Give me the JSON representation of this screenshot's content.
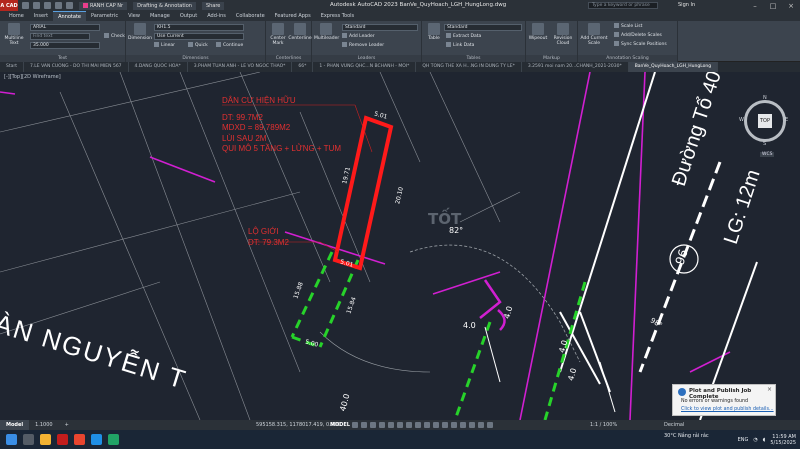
{
  "titlebar": {
    "logo": "A CAD",
    "layer_chip": "RANH CAP Nr",
    "workspace": "Drafting & Annotation",
    "share": "Share",
    "window_title": "Autodesk AutoCAD 2023    BanVe_QuyHoach_LGH_HungLong.dwg",
    "search_placeholder": "Type a keyword or phrase",
    "signin": "Sign In"
  },
  "ribbon_tabs": [
    "Home",
    "Insert",
    "Annotate",
    "Parametric",
    "View",
    "Manage",
    "Output",
    "Add-ins",
    "Collaborate",
    "Featured Apps",
    "Express Tools"
  ],
  "ribbon": {
    "text": {
      "multiline": "Multiline Text",
      "font": "ARIAL",
      "find": "Find text",
      "height": "35.000",
      "check": "Check",
      "group": "Text"
    },
    "dimensions": {
      "dimension": "Dimension",
      "style": "KH1.5",
      "layer": "Use Current",
      "linear": "Linear",
      "quick": "Quick",
      "continue": "Continue",
      "group": "Dimensions"
    },
    "centerlines": {
      "center_mark": "Center Mark",
      "centerline": "Centerline",
      "group": "Centerlines"
    },
    "leaders": {
      "multileader": "Multileader",
      "style": "Standard",
      "add": "Add Leader",
      "remove": "Remove Leader",
      "group": "Leaders"
    },
    "tables": {
      "table": "Table",
      "style": "Standard",
      "extract": "Extract Data",
      "link": "Link Data",
      "group": "Tables"
    },
    "markup": {
      "wipeout": "Wipeout",
      "revision": "Revision Cloud",
      "group": "Markup"
    },
    "annotation_scaling": {
      "add": "Add Current Scale",
      "scale_list": "Scale List",
      "add_delete": "Add/Delete Scales",
      "sync": "Sync Scale Positions",
      "group": "Annotation Scaling"
    }
  },
  "file_tabs": [
    "Start",
    "7.LE VAN CUONG - DO THI MAI MIEN 567",
    "4.DANG QUOC HOA*",
    "3.PHAM TUAN ANH - LE VO NGOC THAO*",
    "66*",
    "1 - PHAN VUNG QHC...N BCHANH - MOI*",
    "QH TONG THE XA H...NG IN DUNG TY LE*",
    "3.2591 moi nam 20...CHANH_2021-2030*",
    "BanVe_QuyHoach_LGH_HungLong"
  ],
  "canvas": {
    "view_label": "[-][Top][2D Wireframe]",
    "lot_info": [
      "DÂN CƯ HIỆN HỮU",
      "DT: 99.7M2",
      "MDXD = 89.789M2",
      "LÙI SAU 2M",
      "QUI MÔ 5 TẦNG + LỬNG + TUM"
    ],
    "lo_gioi": [
      "LỘ GIỚI",
      "DT: 79.3M2"
    ],
    "dims": [
      "5.01",
      "19.71",
      "20.10",
      "5.01",
      "15.88",
      "15.84",
      "5.00"
    ],
    "road_name_right": "Đường Tổ 40",
    "road_width": "LG: 12m",
    "road_number": "96",
    "road_name_left": "ÀN NGUYỄN T",
    "angles": [
      "82°",
      "98°"
    ],
    "road_dims": [
      "4.0",
      "4.0",
      "4.0",
      "4.0",
      "40.0"
    ],
    "watermark": "TỐT"
  },
  "viewcube": {
    "face": "TOP",
    "n": "N",
    "s": "S",
    "e": "E",
    "w": "W",
    "wcs": "WCS"
  },
  "status": {
    "tabs": [
      "Model",
      "1.1000"
    ],
    "coords": "595158.315, 1178017.419, 0.000",
    "model": "MODEL",
    "scale": "1:1 / 100%",
    "units": "Decimal"
  },
  "toast": {
    "title": "Plot and Publish Job Complete",
    "message": "No errors or warnings found",
    "link": "Click to view plot and publish details..."
  },
  "taskbar": {
    "weather": "30°C  Nắng rải rác",
    "lang": "ENG",
    "time": "11:59 AM",
    "date": "5/15/2025"
  }
}
